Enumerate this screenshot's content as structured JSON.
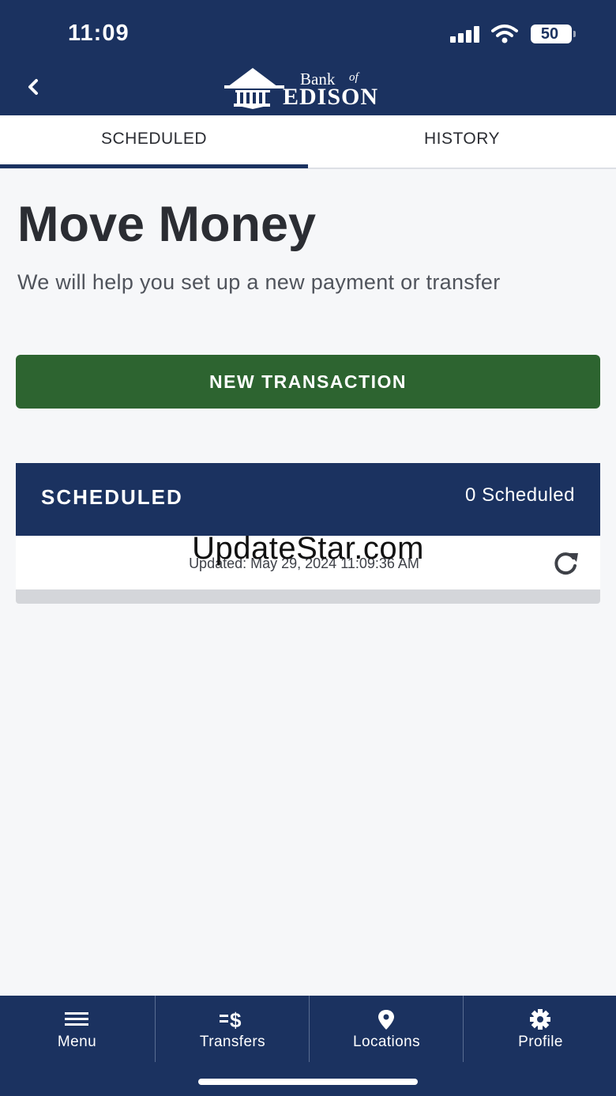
{
  "status_bar": {
    "time": "11:09",
    "battery": "50"
  },
  "header": {
    "logo_bank": "Bank",
    "logo_of": "of",
    "logo_name": "EDISON"
  },
  "tabs": [
    {
      "label": "SCHEDULED",
      "active": true
    },
    {
      "label": "HISTORY",
      "active": false
    }
  ],
  "main": {
    "title": "Move Money",
    "subtitle": "We will help you set up a new payment or transfer",
    "new_transaction_label": "NEW TRANSACTION"
  },
  "scheduled": {
    "title": "SCHEDULED",
    "count_label": "0 Scheduled",
    "updated_text": "Updated: May 29, 2024 11:09:36 AM"
  },
  "watermark": "UpdateStar.com",
  "bottom_nav": [
    {
      "label": "Menu",
      "icon": "menu-icon"
    },
    {
      "label": "Transfers",
      "icon": "transfers-icon"
    },
    {
      "label": "Locations",
      "icon": "location-pin-icon"
    },
    {
      "label": "Profile",
      "icon": "gear-icon"
    }
  ],
  "colors": {
    "navy": "#1b3260",
    "green": "#2d6430",
    "background": "#f6f7f9"
  }
}
